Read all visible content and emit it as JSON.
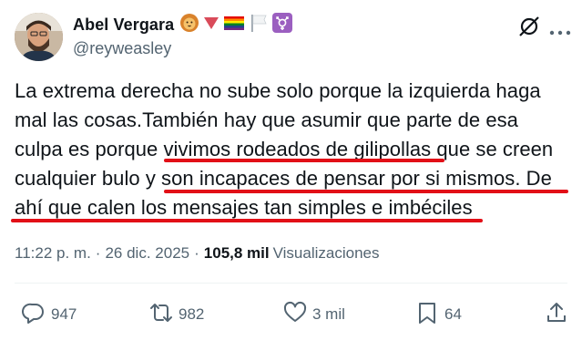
{
  "author": {
    "display_name": "Abel Vergara",
    "handle": "@reyweasley",
    "badges": [
      "lion-emoji",
      "red-triangle-emoji",
      "rainbow-flag-emoji",
      "white-flag-emoji",
      "transgender-symbol-emoji"
    ]
  },
  "tweet": {
    "lines": [
      "La extrema derecha no sube solo porque la izquierda haga",
      "mal las cosas.También hay que asumir que parte de esa",
      "culpa es porque vivimos rodeados de gilipollas que se creen",
      "cualquier bulo y son incapaces de pensar por si mismos. De",
      "ahí que calen los mensajes tan simples e imbéciles"
    ],
    "underline_color": "#e20f17"
  },
  "meta": {
    "time": "11:22 p. m.",
    "separator": "·",
    "date": "26 dic. 2025",
    "views_count": "105,8 mil",
    "views_label": "Visualizaciones"
  },
  "actions": {
    "replies": "947",
    "reposts": "982",
    "likes": "3 mil",
    "bookmarks": "64"
  },
  "colors": {
    "text": "#0f1419",
    "secondary": "#536471",
    "annotation": "#e20f17"
  }
}
